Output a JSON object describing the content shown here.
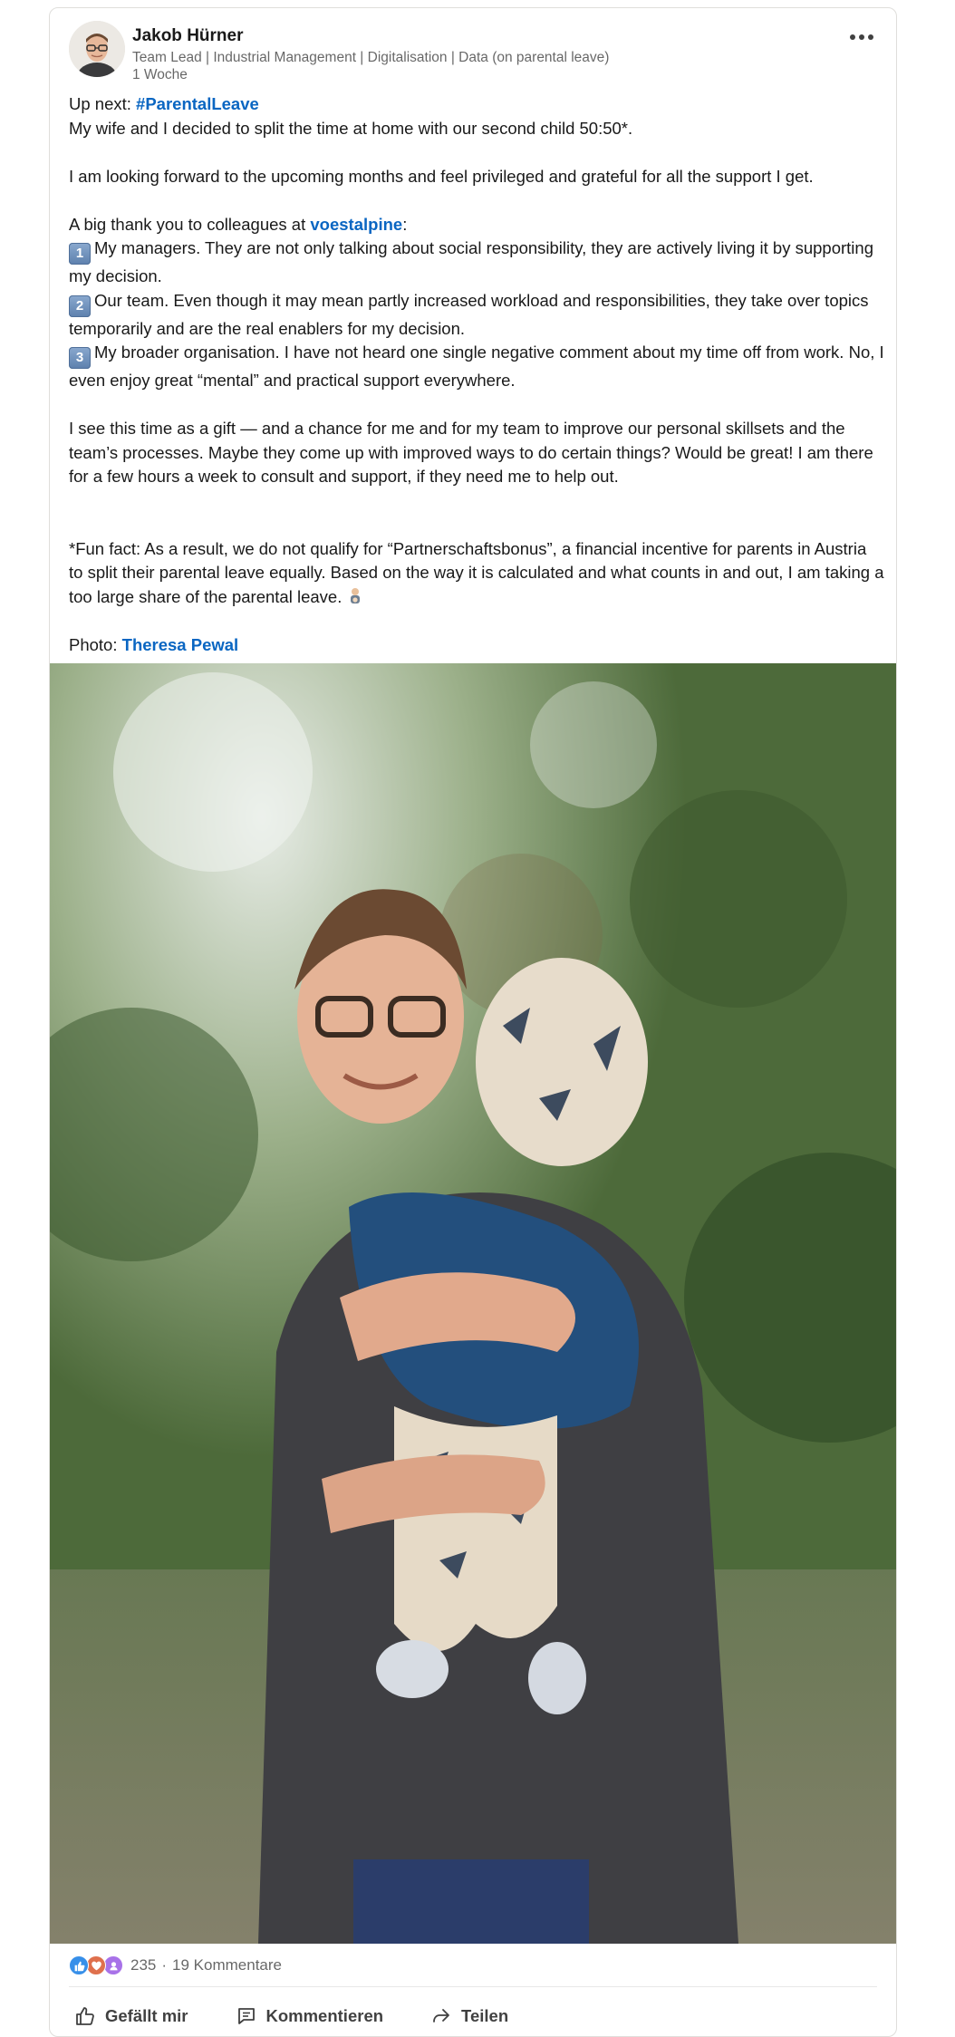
{
  "post": {
    "author": {
      "name": "Jakob Hürner",
      "headline": "Team Lead | Industrial Management | Digitalisation | Data (on parental leave)",
      "time": "1 Woche"
    },
    "body": {
      "intro_prefix": "Up next: ",
      "hashtag": "#ParentalLeave",
      "line_split": "My wife and I decided to split the time at home with our second child 50:50*.",
      "line_grateful": "I am looking forward to the upcoming months and feel privileged and grateful for all the support I get.",
      "thanks_prefix": "A big thank you to colleagues at ",
      "company": "voestalpine",
      "thanks_suffix": ":",
      "items": [
        {
          "key": "1",
          "text": "My managers. They are not only talking about social responsibility, they are actively living it by supporting my decision."
        },
        {
          "key": "2",
          "text": "Our team. Even though it may mean partly increased workload and responsibilities, they take over topics temporarily and are the real enablers for my decision."
        },
        {
          "key": "3",
          "text": "My broader organisation. I have not heard one single negative comment about my time off from work. No, I even enjoy great “mental” and practical support everywhere."
        }
      ],
      "paragraph_gift": "I see this time as a gift — and a chance for me and for my team to improve our personal skillsets and the team’s processes. Maybe they come up with improved ways to do certain things? Would be great! I am there for a few hours a week to consult and support, if they need me to help out.",
      "fun_fact": "*Fun fact: As a result, we do not qualify for “Partnerschaftsbonus”, a financial incentive for parents in Austria to split their parental leave equally. Based on the way it is calculated and what counts in and out, I am taking a too large share of the parental leave.",
      "photo_credit_prefix": "Photo: ",
      "photographer": "Theresa Pewal"
    },
    "social": {
      "reaction_count": "235",
      "separator": "·",
      "comments": "19 Kommentare",
      "reaction_icons": [
        "like-icon",
        "love-icon",
        "support-icon"
      ]
    },
    "actions": {
      "like": "Gefällt mir",
      "comment": "Kommentieren",
      "share": "Teilen"
    }
  },
  "colors": {
    "link": "#0a66c2",
    "like": "#378fe9",
    "love": "#df704d",
    "support": "#a872e8"
  }
}
